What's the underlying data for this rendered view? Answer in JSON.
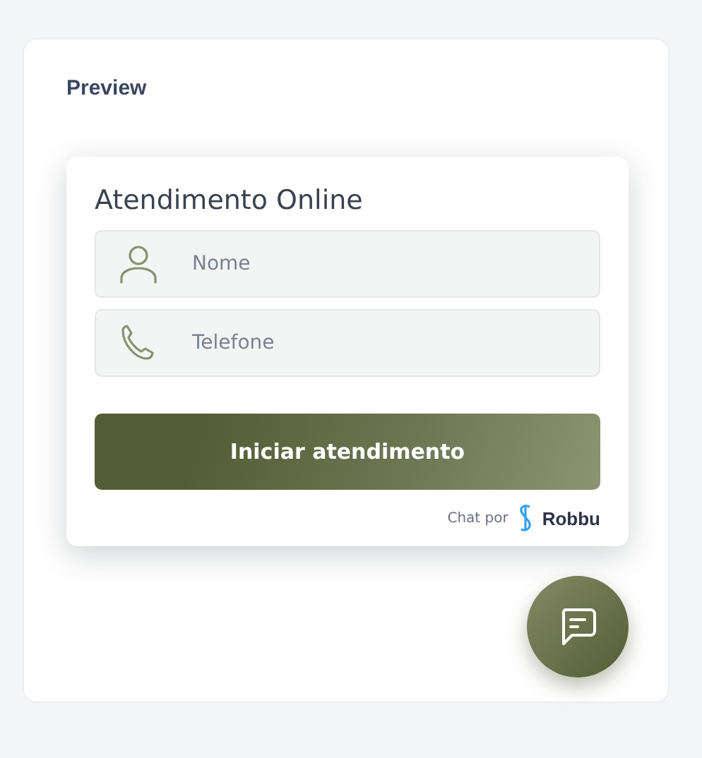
{
  "panel": {
    "title": "Preview"
  },
  "widget": {
    "title": "Atendimento Online",
    "fields": [
      {
        "kind": "person",
        "placeholder": "Nome"
      },
      {
        "kind": "phone",
        "placeholder": "Telefone"
      }
    ],
    "button": "Iniciar atendimento",
    "footer": {
      "label": "Chat por",
      "brand": "Robbu"
    }
  },
  "chat_button": {
    "kind": "chat"
  }
}
